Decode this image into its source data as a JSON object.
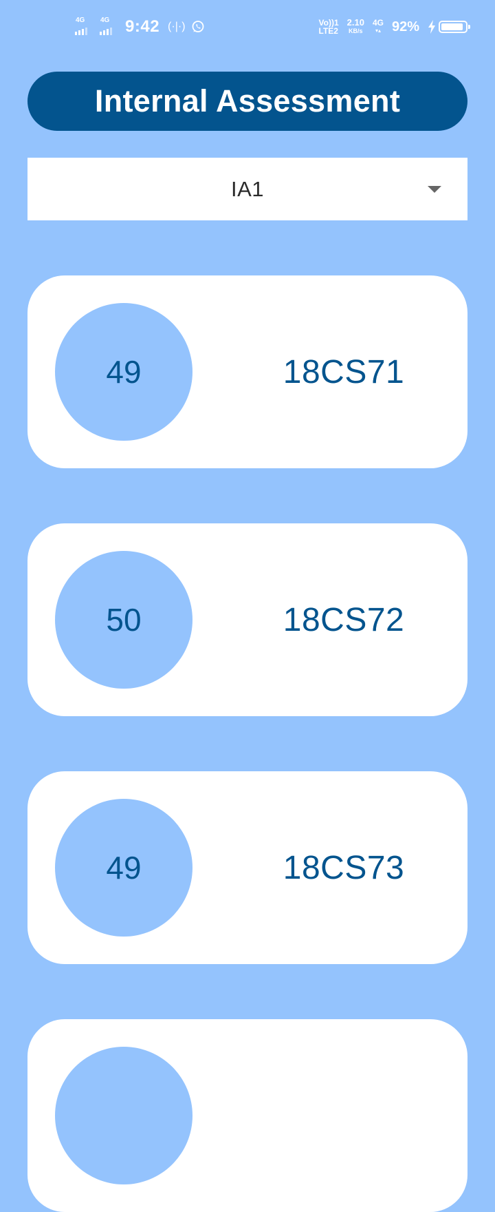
{
  "status_bar": {
    "sim1_label": "4G",
    "sim2_label": "4G",
    "time": "9:42",
    "hotspot_glyph": "(·|·)",
    "volte_line1": "Vo))1",
    "volte_line2": "LTE2",
    "speed_value": "2.10",
    "speed_unit": "KB/s",
    "data_type": "4G",
    "data_arrows": "▾▴",
    "battery_percent": "92%",
    "battery_level": 0.92,
    "icons": [
      "signal-icon",
      "hotspot-icon",
      "whatsapp-icon",
      "charging-icon",
      "battery-icon"
    ]
  },
  "header": {
    "title": "Internal Assessment"
  },
  "dropdown": {
    "selected": "IA1"
  },
  "cards": [
    {
      "score": "49",
      "subject_code": "18CS71"
    },
    {
      "score": "50",
      "subject_code": "18CS72"
    },
    {
      "score": "49",
      "subject_code": "18CS73"
    },
    {
      "score": "",
      "subject_code": ""
    }
  ],
  "colors": {
    "background": "#94c3fd",
    "primary": "#03548e",
    "card": "#ffffff",
    "dropdown_text": "#2b2b2b",
    "chevron": "#666666"
  }
}
